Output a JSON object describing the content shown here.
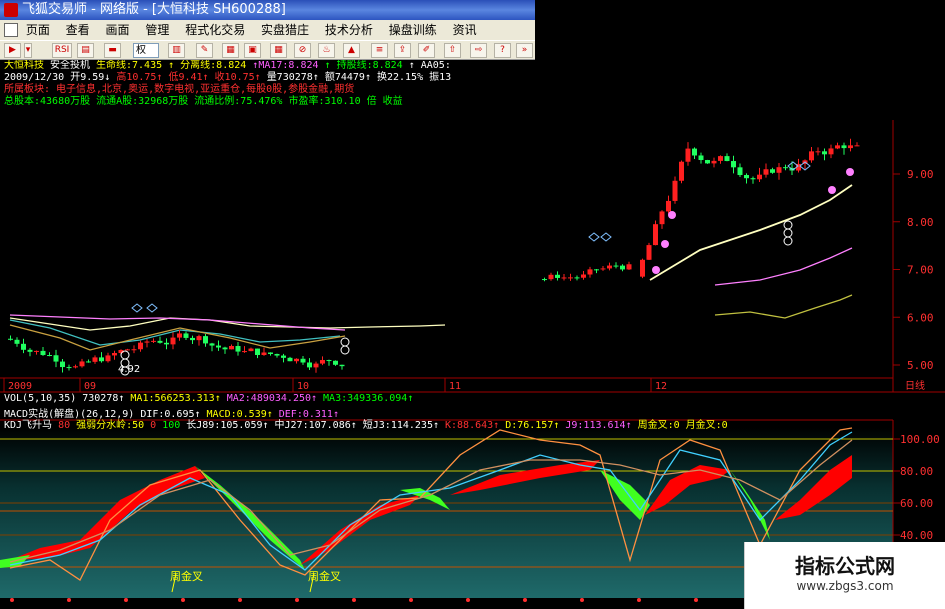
{
  "window": {
    "title": "飞狐交易师 - 网络版 - [大恒科技 SH600288]"
  },
  "menu": [
    "页面",
    "查看",
    "画面",
    "管理",
    "程式化交易",
    "实盘猎庄",
    "技术分析",
    "操盘训练",
    "资讯"
  ],
  "toolbar": {
    "rsi_label": "RSI",
    "select_value": "权"
  },
  "header": {
    "line1": [
      {
        "text": "大恒科技",
        "color": "#ffff00"
      },
      {
        "text": "安全投机",
        "color": "#ffffff"
      },
      {
        "text": "生命线:7.435",
        "color": "#ffff00"
      },
      {
        "text": "↑ 分离线:8.824",
        "color": "#ffff00"
      },
      {
        "text": "↑MA17:8.824",
        "color": "#ff60ff"
      },
      {
        "text": "↑ 持股线:8.824",
        "color": "#00ff00"
      },
      {
        "text": "↑ AA05:",
        "color": "#ffffff"
      }
    ],
    "line2": [
      {
        "text": "2009/12/30",
        "color": "#ffffff"
      },
      {
        "text": "开9.59↓",
        "color": "#ffffff"
      },
      {
        "text": "高10.75↑",
        "color": "#ff3030"
      },
      {
        "text": "低9.41↑",
        "color": "#ff3030"
      },
      {
        "text": "收10.75↑",
        "color": "#ff3030"
      },
      {
        "text": "量730278↑",
        "color": "#ffffff"
      },
      {
        "text": "额74479↑",
        "color": "#ffffff"
      },
      {
        "text": "换22.15%",
        "color": "#ffffff"
      },
      {
        "text": "振13",
        "color": "#ffffff"
      }
    ],
    "line3": [
      {
        "text": "所属板块:",
        "color": "#ff3030"
      },
      {
        "text": "电子信息,北京,奥运,数字电视,亚运重仓,每股0股,参股金融,期货",
        "color": "#ff3030"
      }
    ],
    "line4": [
      {
        "text": "总股本:43680万股",
        "color": "#00ff00"
      },
      {
        "text": "流通A股:32968万股",
        "color": "#00ff00"
      },
      {
        "text": "流通比例:75.476%",
        "color": "#00ff00"
      },
      {
        "text": "市盈率:310.10 倍",
        "color": "#00ff00"
      },
      {
        "text": "收益",
        "color": "#00ff00"
      }
    ]
  },
  "price_axis": {
    "labels": [
      "9.00",
      "8.00",
      "7.00",
      "6.00",
      "5.00"
    ],
    "values": [
      9,
      8,
      7,
      6,
      5
    ]
  },
  "annotations": {
    "low_label": "4.92"
  },
  "date_axis": {
    "labels": [
      "2009",
      "09",
      "10",
      "11",
      "12"
    ],
    "period": "日线"
  },
  "vol_line": [
    {
      "text": "VOL(5,10,35)",
      "color": "#ffffff"
    },
    {
      "text": "730278↑",
      "color": "#ffffff"
    },
    {
      "text": "MA1:566253.313↑",
      "color": "#ffff00"
    },
    {
      "text": "MA2:489034.250↑",
      "color": "#ff60ff"
    },
    {
      "text": "MA3:349336.094↑",
      "color": "#00ff00"
    }
  ],
  "macd_line": [
    {
      "text": "MACD实战(解盘)(26,12,9)",
      "color": "#ffffff"
    },
    {
      "text": "DIF:0.695↑",
      "color": "#ffffff"
    },
    {
      "text": "MACD:0.539↑",
      "color": "#ffff00"
    },
    {
      "text": "DEF:0.311↑",
      "color": "#ff60ff"
    }
  ],
  "kdj_line": [
    {
      "text": "KDJ飞升马",
      "color": "#ffffff"
    },
    {
      "text": "80",
      "color": "#ff3030"
    },
    {
      "text": "强弱分水岭:50",
      "color": "#ffff00"
    },
    {
      "text": "0",
      "color": "#ff3030"
    },
    {
      "text": "100",
      "color": "#00ff00"
    },
    {
      "text": "长J89:105.059↑",
      "color": "#ffffff"
    },
    {
      "text": "中J27:107.086↑",
      "color": "#ffffff"
    },
    {
      "text": "短J3:114.235↑",
      "color": "#ffffff"
    },
    {
      "text": "K:88.643↑",
      "color": "#ff3030"
    },
    {
      "text": "D:76.157↑",
      "color": "#ffff00"
    },
    {
      "text": "J9:113.614↑",
      "color": "#ff60ff"
    },
    {
      "text": "周金叉:0",
      "color": "#ffff00"
    },
    {
      "text": "月金叉:0",
      "color": "#ffff00"
    }
  ],
  "kdj_axis": {
    "labels": [
      "100.00",
      "80.00",
      "60.00",
      "40.00"
    ],
    "values": [
      100,
      80,
      60,
      40
    ]
  },
  "kdj_markers": [
    "周金叉",
    "周金叉"
  ],
  "watermark": {
    "brand": "指标公式网",
    "url": "www.zbgs3.com"
  },
  "colors": {
    "up": "#ff2020",
    "down": "#20ff60",
    "ma_fast": "#ffffc0",
    "ma_purple": "#ff80ff",
    "ma_olive": "#c0c040",
    "kdj_red": "#ff0000",
    "kdj_green": "#40ff20",
    "kdj_cyan": "#40d0ff",
    "kdj_orange": "#ff9040"
  }
}
